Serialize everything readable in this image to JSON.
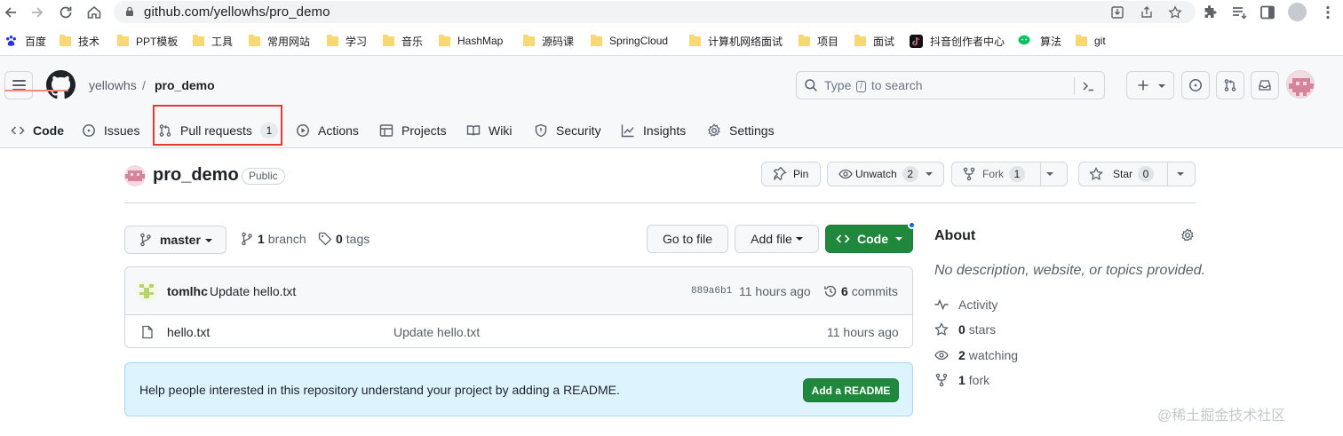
{
  "browser": {
    "url": "github.com/yellowhs/pro_demo",
    "bookmarks": [
      "百度",
      "技术",
      "PPT模板",
      "工具",
      "常用网站",
      "学习",
      "音乐",
      "HashMap",
      "源码课",
      "SpringCloud",
      "计算机网络面试",
      "项目",
      "面试",
      "抖音创作者中心",
      "算法",
      "git"
    ]
  },
  "header": {
    "owner": "yellowhs",
    "separator": "/",
    "repo": "pro_demo",
    "search_prefix": "Type",
    "search_key": "/",
    "search_suffix": "to search"
  },
  "tabs": [
    {
      "label": "Code",
      "icon": "code-icon"
    },
    {
      "label": "Issues",
      "icon": "issue-icon"
    },
    {
      "label": "Pull requests",
      "icon": "pull-request-icon",
      "count": "1"
    },
    {
      "label": "Actions",
      "icon": "play-icon"
    },
    {
      "label": "Projects",
      "icon": "table-icon"
    },
    {
      "label": "Wiki",
      "icon": "book-icon"
    },
    {
      "label": "Security",
      "icon": "shield-icon"
    },
    {
      "label": "Insights",
      "icon": "graph-icon"
    },
    {
      "label": "Settings",
      "icon": "gear-icon"
    }
  ],
  "repo": {
    "name": "pro_demo",
    "visibility": "Public",
    "pin_label": "Pin",
    "watch_label": "Unwatch",
    "watch_count": "2",
    "fork_label": "Fork",
    "fork_count": "1",
    "star_label": "Star",
    "star_count": "0"
  },
  "filenav": {
    "branch": "master",
    "branch_count": "1",
    "branch_label": "branch",
    "tag_count": "0",
    "tag_label": "tags",
    "goto_file": "Go to file",
    "add_file": "Add file",
    "code": "Code"
  },
  "commit": {
    "author": "tomlhc",
    "message": "Update hello.txt",
    "sha": "889a6b1",
    "time": "11 hours ago",
    "count": "6",
    "count_label": "commits"
  },
  "files": [
    {
      "name": "hello.txt",
      "commit": "Update hello.txt",
      "time": "11 hours ago"
    }
  ],
  "readme": {
    "text": "Help people interested in this repository understand your project by adding a README.",
    "button": "Add a README"
  },
  "about": {
    "title": "About",
    "description": "No description, website, or topics provided.",
    "activity": "Activity",
    "stars_count": "0",
    "stars_label": "stars",
    "watching_count": "2",
    "watching_label": "watching",
    "fork_count": "1",
    "fork_label": "fork"
  },
  "watermark": "@稀土掘金技术社区",
  "colors": {
    "primary_button": "#1f883d",
    "active_tab_underline": "#fd8c73",
    "highlight_box": "#e53935",
    "readme_background": "#ddf4ff"
  }
}
